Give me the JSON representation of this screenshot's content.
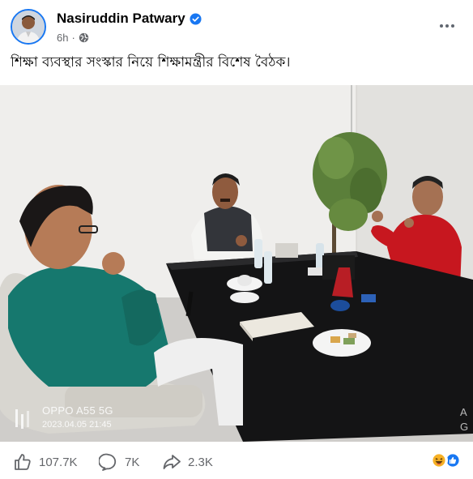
{
  "post": {
    "author": "Nasiruddin Patwary",
    "time": "6h",
    "separator": "·",
    "caption": "শিক্ষা ব্যবস্থার সংস্কার নিয়ে শিক্ষামন্ত্রীর বিশেষ বৈঠক।",
    "photo": {
      "watermark_model": "OPPO A55 5G",
      "watermark_datetime": "2023.04.05 21:45",
      "edge_letters": "A\nG"
    },
    "stats": {
      "likes": "107.7K",
      "comments": "7K",
      "shares": "2.3K"
    },
    "icons": {
      "verified": "verified-badge-icon",
      "audience": "globe-icon",
      "more": "more-options-icon",
      "like": "like-icon",
      "comment": "comment-icon",
      "share": "share-icon",
      "reactions": [
        "haha-reaction-icon",
        "like-reaction-icon"
      ]
    },
    "colors": {
      "brand_blue": "#1877f2",
      "text_secondary": "#65676b",
      "haha_yellow": "#f7b125"
    }
  }
}
